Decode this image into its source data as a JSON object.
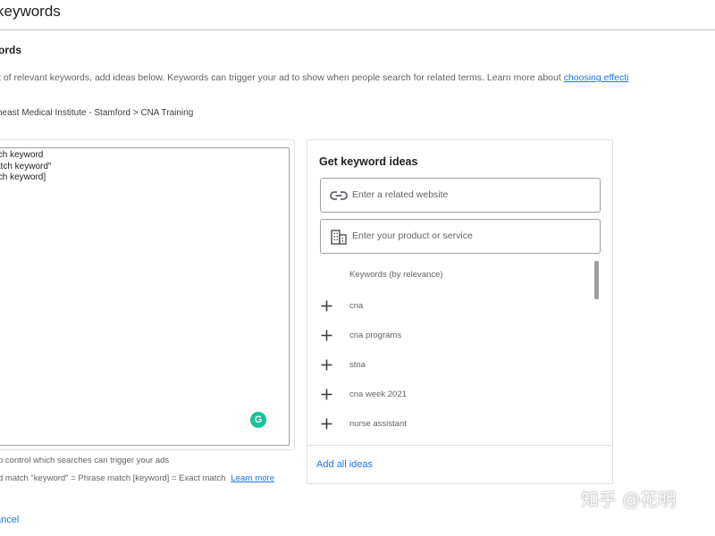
{
  "header": {
    "title": "keywords"
  },
  "section": {
    "title": "ords"
  },
  "description": {
    "text": "t of relevant keywords, add ideas below. Keywords can trigger your ad to show when people search for related terms. Learn more about ",
    "link": "choosing effecti"
  },
  "breadcrumb": "heast Medical Institute - Stamford > CNA Training",
  "keyword_box": {
    "lines": [
      "tch keyword",
      "atch keyword\"",
      "tch keyword]"
    ],
    "grammarly_label": "G"
  },
  "helper": {
    "text": "p control which searches can trigger your ads",
    "match_text": "d match   \"keyword\" = Phrase match   [keyword] = Exact match",
    "learn_more": "Learn more"
  },
  "cancel_label": "ancel",
  "ideas": {
    "title": "Get keyword ideas",
    "website_placeholder": "Enter a related website",
    "product_placeholder": "Enter your product or service",
    "list_header": "Keywords (by relevance)",
    "items": [
      {
        "label": "cna"
      },
      {
        "label": "cna programs"
      },
      {
        "label": "stna"
      },
      {
        "label": "cna week 2021"
      },
      {
        "label": "nurse assistant"
      }
    ],
    "add_all_label": "Add all ideas"
  },
  "watermark": "知乎 @花明",
  "colors": {
    "link": "#1a73e8",
    "grammarly": "#15c39a",
    "border": "#9e9e9e"
  },
  "icons": {
    "website": "link-icon",
    "product": "building-icon",
    "add": "plus-icon"
  }
}
